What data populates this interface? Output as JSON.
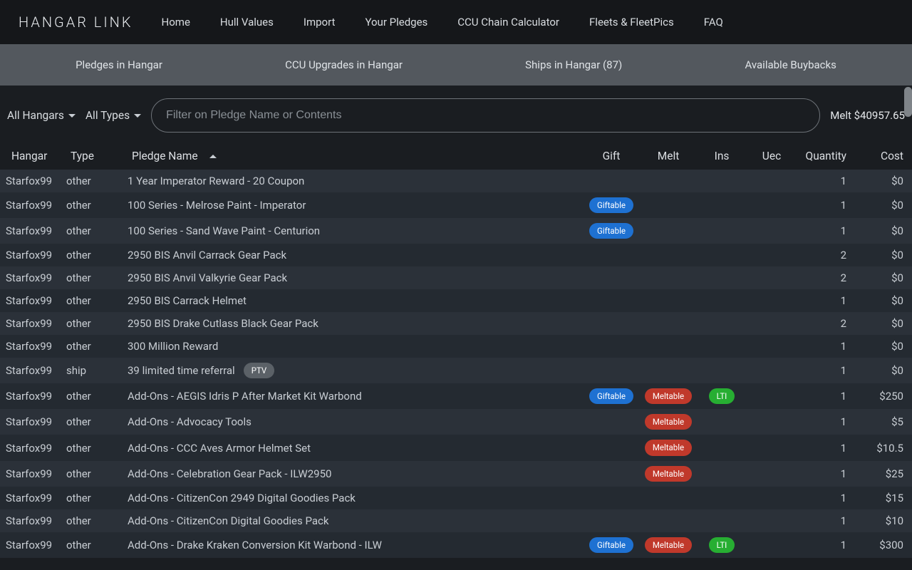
{
  "brand": "HANGAR LINK",
  "nav": [
    "Home",
    "Hull Values",
    "Import",
    "Your Pledges",
    "CCU Chain Calculator",
    "Fleets & FleetPics",
    "FAQ"
  ],
  "subnav": [
    "Pledges in Hangar",
    "CCU Upgrades in Hangar",
    "Ships in Hangar (87)",
    "Available Buybacks"
  ],
  "filters": {
    "hangar_dd": "All Hangars",
    "type_dd": "All Types",
    "search_placeholder": "Filter on Pledge Name or Contents",
    "melt_total": "Melt $40957.65"
  },
  "columns": {
    "hangar": "Hangar",
    "type": "Type",
    "name": "Pledge Name",
    "gift": "Gift",
    "melt": "Melt",
    "ins": "Ins",
    "uec": "Uec",
    "qty": "Quantity",
    "cost": "Cost"
  },
  "badge_labels": {
    "giftable": "Giftable",
    "meltable": "Meltable",
    "lti": "LTI",
    "ptv": "PTV"
  },
  "rows": [
    {
      "hangar": "Starfox99",
      "type": "other",
      "name": "1 Year Imperator Reward - 20 Coupon",
      "gift": "",
      "melt": "",
      "ins": "",
      "qty": "1",
      "cost": "$0"
    },
    {
      "hangar": "Starfox99",
      "type": "other",
      "name": "100 Series - Melrose Paint - Imperator",
      "gift": "giftable",
      "melt": "",
      "ins": "",
      "qty": "1",
      "cost": "$0"
    },
    {
      "hangar": "Starfox99",
      "type": "other",
      "name": "100 Series - Sand Wave Paint - Centurion",
      "gift": "giftable",
      "melt": "",
      "ins": "",
      "qty": "1",
      "cost": "$0"
    },
    {
      "hangar": "Starfox99",
      "type": "other",
      "name": "2950 BIS Anvil Carrack Gear Pack",
      "gift": "",
      "melt": "",
      "ins": "",
      "qty": "2",
      "cost": "$0"
    },
    {
      "hangar": "Starfox99",
      "type": "other",
      "name": "2950 BIS Anvil Valkyrie Gear Pack",
      "gift": "",
      "melt": "",
      "ins": "",
      "qty": "2",
      "cost": "$0"
    },
    {
      "hangar": "Starfox99",
      "type": "other",
      "name": "2950 BIS Carrack Helmet",
      "gift": "",
      "melt": "",
      "ins": "",
      "qty": "1",
      "cost": "$0"
    },
    {
      "hangar": "Starfox99",
      "type": "other",
      "name": "2950 BIS Drake Cutlass Black Gear Pack",
      "gift": "",
      "melt": "",
      "ins": "",
      "qty": "2",
      "cost": "$0"
    },
    {
      "hangar": "Starfox99",
      "type": "other",
      "name": "300 Million Reward",
      "gift": "",
      "melt": "",
      "ins": "",
      "qty": "1",
      "cost": "$0"
    },
    {
      "hangar": "Starfox99",
      "type": "ship",
      "name": "39 limited time referral",
      "tag": "ptv",
      "gift": "",
      "melt": "",
      "ins": "",
      "qty": "1",
      "cost": "$0"
    },
    {
      "hangar": "Starfox99",
      "type": "other",
      "name": "Add-Ons - AEGIS Idris P After Market Kit Warbond",
      "gift": "giftable",
      "melt": "meltable",
      "ins": "lti",
      "qty": "1",
      "cost": "$250"
    },
    {
      "hangar": "Starfox99",
      "type": "other",
      "name": "Add-Ons - Advocacy Tools",
      "gift": "",
      "melt": "meltable",
      "ins": "",
      "qty": "1",
      "cost": "$5"
    },
    {
      "hangar": "Starfox99",
      "type": "other",
      "name": "Add-Ons - CCC Aves Armor  Helmet Set",
      "gift": "",
      "melt": "meltable",
      "ins": "",
      "qty": "1",
      "cost": "$10.5"
    },
    {
      "hangar": "Starfox99",
      "type": "other",
      "name": "Add-Ons - Celebration Gear Pack - ILW2950",
      "gift": "",
      "melt": "meltable",
      "ins": "",
      "qty": "1",
      "cost": "$25"
    },
    {
      "hangar": "Starfox99",
      "type": "other",
      "name": "Add-Ons - CitizenCon 2949 Digital Goodies Pack",
      "gift": "",
      "melt": "",
      "ins": "",
      "qty": "1",
      "cost": "$15"
    },
    {
      "hangar": "Starfox99",
      "type": "other",
      "name": "Add-Ons - CitizenCon Digital Goodies Pack",
      "gift": "",
      "melt": "",
      "ins": "",
      "qty": "1",
      "cost": "$10"
    },
    {
      "hangar": "Starfox99",
      "type": "other",
      "name": "Add-Ons - Drake Kraken Conversion Kit Warbond - ILW",
      "gift": "giftable",
      "melt": "meltable",
      "ins": "lti",
      "qty": "1",
      "cost": "$300"
    }
  ]
}
